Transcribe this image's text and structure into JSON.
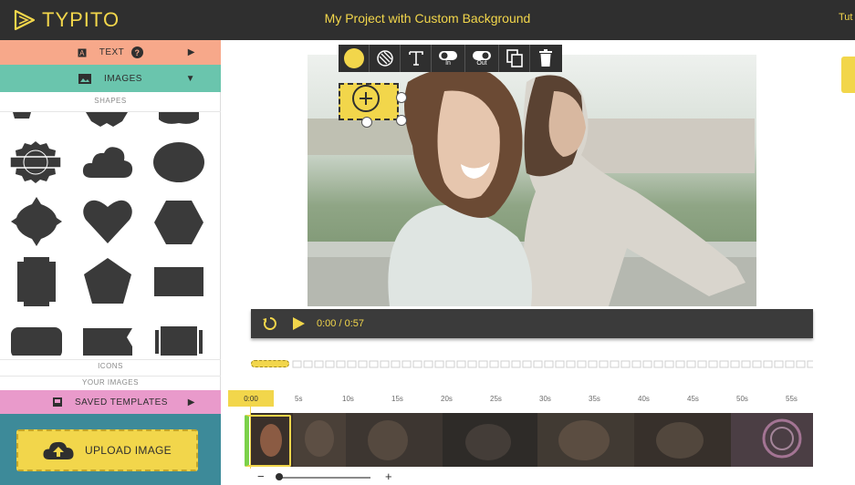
{
  "app": {
    "logo_text": "TYPITO",
    "project_title": "My Project with Custom Background",
    "tutorial_link": "Tut"
  },
  "left_panel": {
    "text_label": "TEXT",
    "help_icon": "question-circle-icon",
    "images_label": "IMAGES",
    "shapes_label": "SHAPES",
    "shape_items": [
      "scroll-top",
      "ribbon-top",
      "banner-top",
      "badge",
      "cloud",
      "ellipse",
      "rhombus",
      "heart",
      "hexagon",
      "shield",
      "pentagon",
      "rectangle",
      "rounded-rectangle",
      "flag",
      "ticket"
    ],
    "icons_label": "ICONS",
    "your_images_label": "YOUR IMAGES",
    "saved_templates_label": "SAVED TEMPLATES",
    "upload_label": "UPLOAD IMAGE"
  },
  "toolbar": {
    "in_label": "In",
    "out_label": "Out"
  },
  "player": {
    "current_time": "0:00",
    "separator": "/",
    "total_time": "0:57"
  },
  "timeline": {
    "marker": "0:00",
    "ticks": [
      "5s",
      "10s",
      "15s",
      "20s",
      "25s",
      "30s",
      "35s",
      "40s",
      "45s",
      "50s",
      "55s"
    ]
  },
  "zoom": {
    "minus": "−",
    "plus": "+",
    "level": 0.0
  },
  "colors": {
    "accent_yellow": "#f2d64b",
    "header_dark": "#2f2f2f",
    "text_tab": "#f7a88a",
    "images_tab": "#6ac5ad",
    "saved_tab": "#e99acb",
    "upload_bg": "#3d8a99"
  }
}
